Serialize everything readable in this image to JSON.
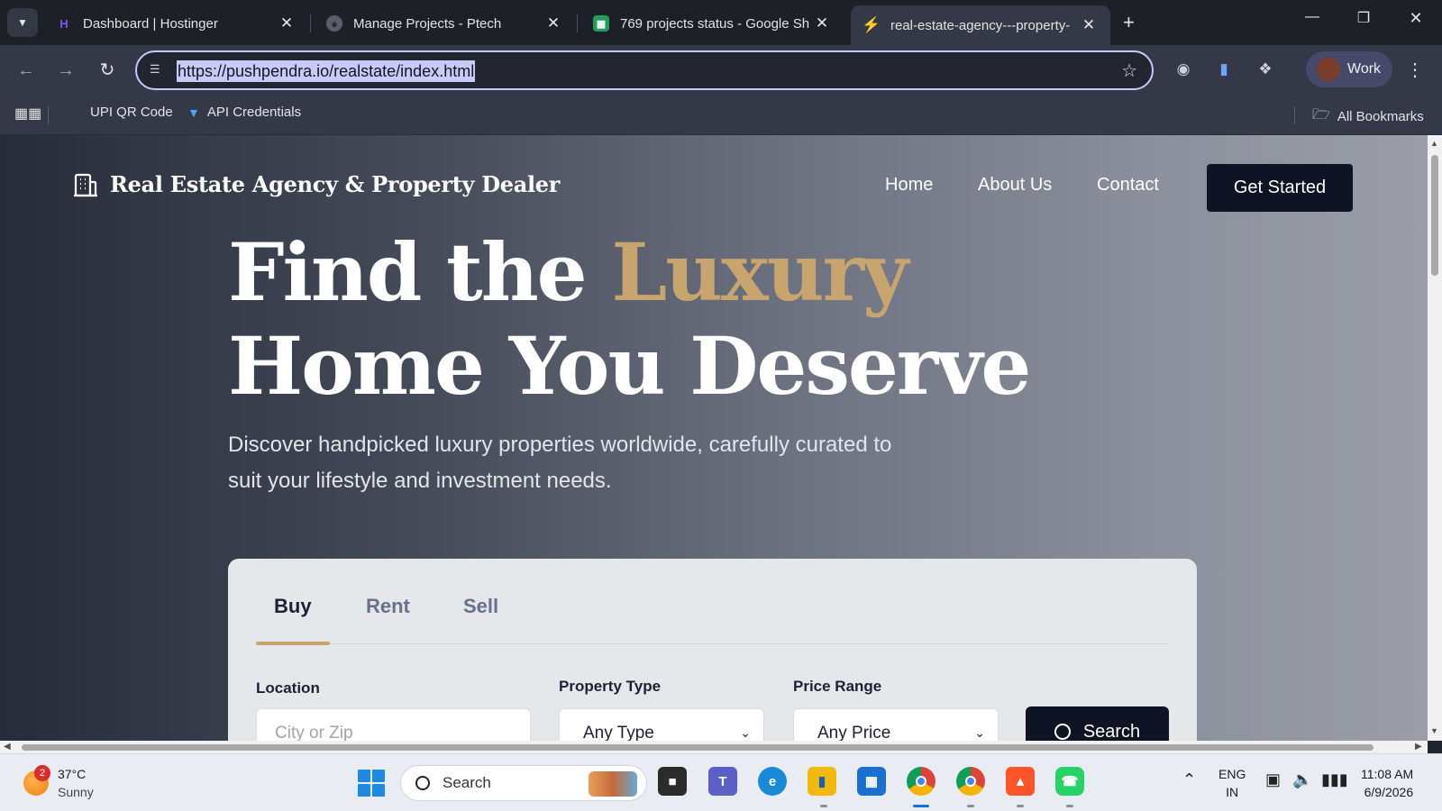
{
  "browser": {
    "tabs": [
      {
        "title": "Dashboard | Hostinger",
        "favicon": "hostinger-icon",
        "color": "#673de6",
        "active": false
      },
      {
        "title": "Manage Projects - Ptech",
        "favicon": "globe-icon",
        "color": "#6c6f7a",
        "active": false
      },
      {
        "title": "769 projects status - Google Sh",
        "favicon": "sheets-icon",
        "color": "#1e9e5a",
        "active": false
      },
      {
        "title": "real-estate-agency---property-",
        "favicon": "bolt-icon",
        "color": "#8b5cf6",
        "active": true
      }
    ],
    "url": "https://pushpendra.io/realstate/index.html",
    "profile_label": "Work",
    "bookmarks": [
      {
        "label": "UPI QR Code",
        "icon": ""
      },
      {
        "label": "API Credentials",
        "icon": "bookmark-brand-icon"
      }
    ],
    "all_bookmarks_label": "All Bookmarks"
  },
  "site": {
    "brand": "Real Estate Agency & Property Dealer",
    "nav": [
      "Home",
      "About Us",
      "Contact"
    ],
    "cta": "Get Started",
    "hero": {
      "line1_before": "Find the ",
      "line1_accent": "Luxury",
      "line2": "Home You Deserve",
      "accent_color": "#c8a46e",
      "subtitle": "Discover handpicked luxury properties worldwide, carefully curated to suit your lifestyle and investment needs."
    },
    "search": {
      "tabs": [
        "Buy",
        "Rent",
        "Sell"
      ],
      "active_tab": "Buy",
      "location_label": "Location",
      "location_placeholder": "City or Zip",
      "type_label": "Property Type",
      "type_value": "Any Type",
      "price_label": "Price Range",
      "price_value": "Any Price",
      "button": "Search"
    }
  },
  "taskbar": {
    "weather": {
      "temp": "37°C",
      "condition": "Sunny",
      "badge": "2"
    },
    "search_label": "Search",
    "lang_line1": "ENG",
    "lang_line2": "IN",
    "time": "11:08 AM",
    "date": "6/9/2026"
  }
}
